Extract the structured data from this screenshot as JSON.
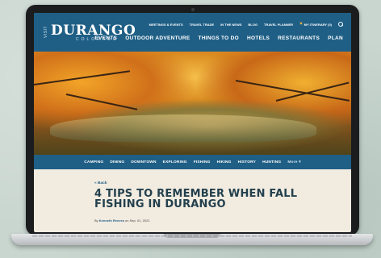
{
  "site": {
    "logo_prefix": "VISIT",
    "logo_main": "DURANGO",
    "logo_sub": "COLORADO"
  },
  "utility_nav": [
    "MEETINGS & EVENTS",
    "TRAVEL TRADE",
    "IN THE NEWS",
    "BLOG",
    "TRAVEL PLANNER"
  ],
  "itinerary_label": "MY ITINERARY (0)",
  "main_nav": [
    "EVENTS",
    "OUTDOOR ADVENTURE",
    "THINGS TO DO",
    "HOTELS",
    "RESTAURANTS",
    "PLAN"
  ],
  "sub_nav": [
    "CAMPING",
    "DINING",
    "DOWNTOWN",
    "EXPLORING",
    "FISHING",
    "HIKING",
    "HISTORY",
    "HUNTING"
  ],
  "sub_nav_more": "More ▾",
  "article": {
    "back_label": "« Back",
    "title": "4 TIPS TO REMEMBER WHEN FALL FISHING IN DURANGO",
    "byline_prefix": "By",
    "author": "Kenneth Reeves",
    "byline_date": "on Sep. 01, 2021"
  },
  "colors": {
    "brand_blue": "#1f5f86",
    "title_text": "#23404d",
    "page_bg": "#f1ebe0"
  }
}
